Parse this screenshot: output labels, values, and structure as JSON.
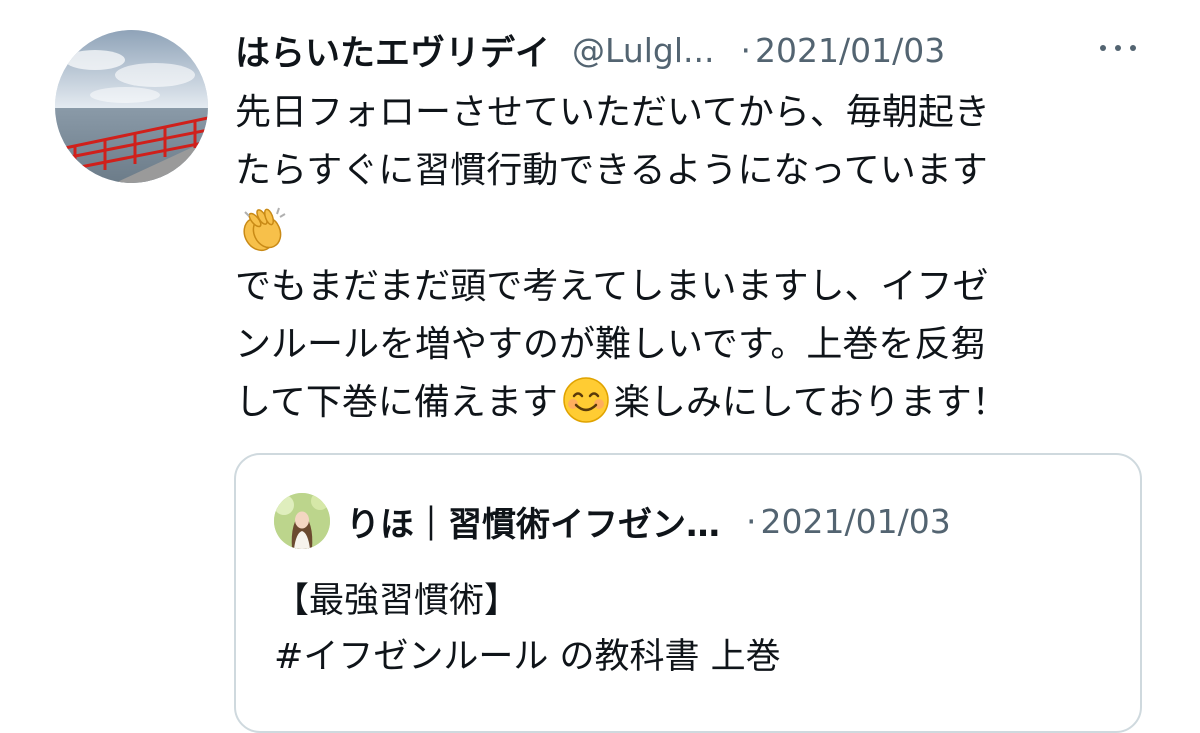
{
  "tweet": {
    "avatar_icon": "profile-photo-sea-railing",
    "display_name": "はらいたエヴリデイ",
    "handle": "@Lulgl...",
    "separator": "·",
    "date": "2021/01/03",
    "more_icon": "more-horizontal-icon",
    "lines": [
      "先日フォローさせていただいてから、毎朝起き",
      "たらすぐに習慣行動できるようになっています",
      "でもまだまだ頭で考えてしまいますし、イフゼ",
      "ンルールを増やすのが難しいです。上巻を反芻",
      "して下巻に備えます",
      "楽しみにしております！"
    ],
    "emojis": [
      "clapping-hands-emoji",
      "smiling-face-emoji"
    ]
  },
  "quoted": {
    "avatar_icon": "profile-photo-woman",
    "display_name": "りほ｜習慣術イフゼン…",
    "separator": "·",
    "date": "2021/01/03",
    "lines": [
      "【最強習慣術】",
      "#イフゼンルール の教科書 上巻"
    ]
  }
}
